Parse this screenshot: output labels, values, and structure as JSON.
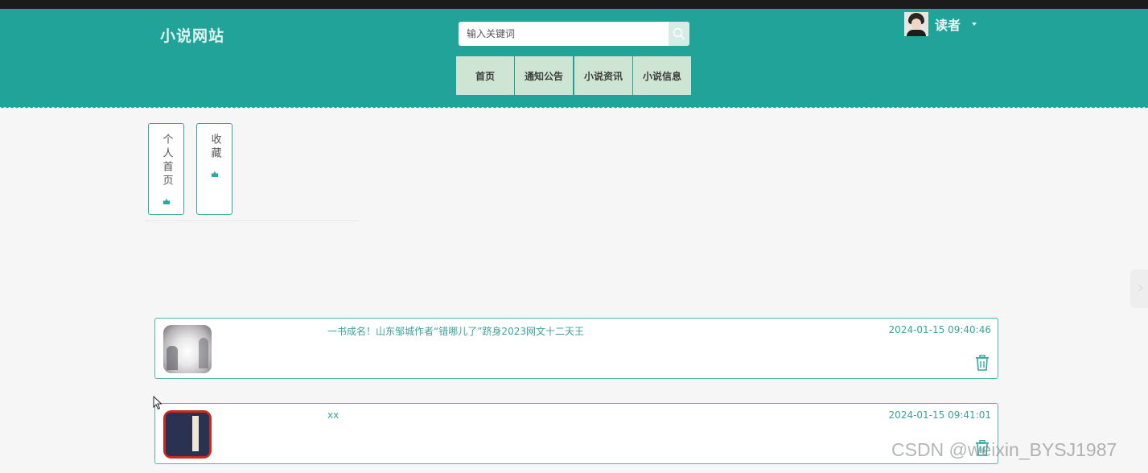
{
  "site": {
    "logo": "小说网站"
  },
  "search": {
    "placeholder": "输入关键词"
  },
  "nav": [
    {
      "label": "首页"
    },
    {
      "label": "通知公告"
    },
    {
      "label": "小说资讯"
    },
    {
      "label": "小说信息"
    }
  ],
  "user": {
    "name": "读者"
  },
  "side_tabs": [
    {
      "label": "个人首页"
    },
    {
      "label": "收藏"
    }
  ],
  "favorites": [
    {
      "title": "一书成名！山东邹城作者“错哪儿了”跻身2023网文十二天王",
      "time": "2024-01-15 09:40:46"
    },
    {
      "title": "xx",
      "time": "2024-01-15 09:41:01"
    }
  ],
  "watermark": "CSDN @weixin_BYSJ1987",
  "colors": {
    "header": "#21a39a",
    "nav_bg": "#cfe5d3",
    "accent": "#3aa39b",
    "page_bg": "#f6f6f6"
  }
}
